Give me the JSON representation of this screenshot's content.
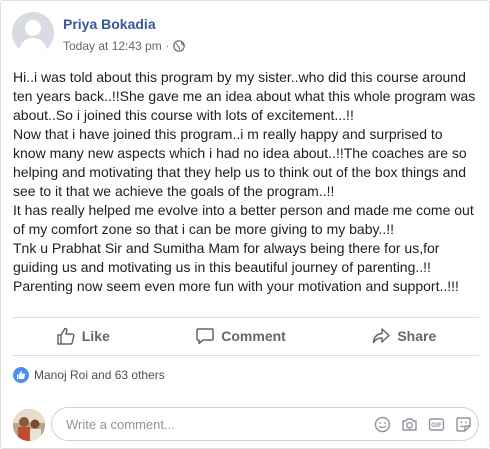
{
  "post": {
    "author_name": "Priya Bokadia",
    "timestamp": "Today at 12:43 pm",
    "separator": "·",
    "privacy_icon": "globe-icon",
    "text_lines": [
      "Hi..i was told about this program by my sister..who did this course around",
      "ten years back..!!She gave me an idea about what this whole program was",
      "about..So i joined this course with lots of excitement...!!",
      "Now that i have joined this program..i m really happy and surprised to",
      "know many new aspects which i had no idea about..!!The coaches are so",
      "helping and motivating that they help us to think out of the box things and",
      "see to it that we achieve the goals of the program..!!",
      "It has really helped me evolve into a better person and made me come out",
      "of my comfort zone so that i can be more giving to my baby..!!",
      "Tnk u Prabhat Sir and Sumitha Mam for always being there for us,for",
      "guiding us and motivating us in this beautiful journey of parenting..!!",
      "Parenting now seem even more fun with your motivation and support..!!!"
    ]
  },
  "actions": {
    "like_label": "Like",
    "comment_label": "Comment",
    "share_label": "Share"
  },
  "reactions": {
    "summary": "Manoj Roi and 63 others",
    "icon": "thumbs-up-icon"
  },
  "comment_box": {
    "placeholder": "Write a comment...",
    "icons": [
      "smiley-icon",
      "camera-icon",
      "gif-icon",
      "sticker-icon"
    ]
  },
  "colors": {
    "name_blue": "#385898",
    "meta_gray": "#616770",
    "action_gray": "#606770",
    "like_blue": "#4a90f0",
    "divider": "#dadde1"
  }
}
